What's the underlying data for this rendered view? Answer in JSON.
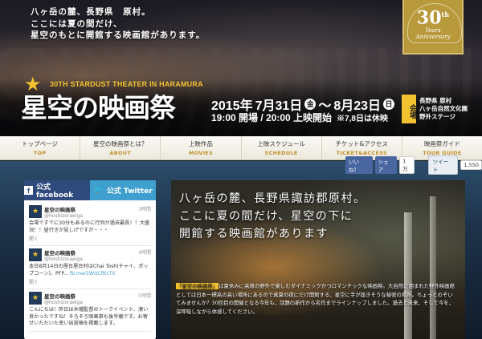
{
  "hero": {
    "tagline": [
      "八ヶ岳の麓、長野県　原村。",
      "ここには夏の間だけ、",
      "星空のもとに開館する映画館があります。"
    ],
    "badge": {
      "number": "30",
      "suffix": "th",
      "line1": "Years",
      "line2": "Anniversary"
    },
    "subtitle": "30TH STARDUST THEATER IN HARAMURA",
    "title": "星空の映画祭",
    "date": {
      "year": "2015年",
      "start": "7月31日",
      "start_dow": "金",
      "sep": "～",
      "end": "8月23日",
      "end_dow": "日"
    },
    "time": {
      "open": "19:00 開場 / 20:00 上映開始",
      "note": "※7,8日は休映"
    },
    "venue": {
      "label": "会場",
      "lines": [
        "長野県 原村",
        "八ヶ岳自然文化園",
        "野外ステージ"
      ]
    }
  },
  "nav": [
    {
      "jp": "トップページ",
      "en": "TOP"
    },
    {
      "jp": "星空の映画祭とは？",
      "en": "ABOUT"
    },
    {
      "jp": "上映作品",
      "en": "MOVIES"
    },
    {
      "jp": "上映スケジュール",
      "en": "SCHEDULE"
    },
    {
      "jp": "チケット&アクセス",
      "en": "TICKET&ACCESS"
    },
    {
      "jp": "映画祭ガイド",
      "en": "TOUR GUIDE"
    }
  ],
  "share": {
    "like": "いいね！",
    "share": "シェア",
    "fb_count": "1万",
    "tweet": "ツイート",
    "tw_count": "1,550"
  },
  "social": {
    "tab_facebook": "公式 facebook",
    "tab_twitter": "公式 Twitter",
    "tweets": [
      {
        "name": "星空の映画祭",
        "handle": "@hoshizoraeiga",
        "time": "3時間",
        "body": "会場ですでに30分もあるのに行列が過去最長！！大盛況！！昼行きが見しげですが・・・",
        "link": "",
        "open": "開く"
      },
      {
        "name": "星空の映画祭",
        "handle": "@hoshizoraeiga",
        "time": "4時間",
        "body": "本日8月14日の屋台屋台村はChai Tosh(チャイ、ポップコーン)、PFP...",
        "link": "fb.me/1WUCfKcTX",
        "open": "開く"
      },
      {
        "name": "星空の映画祭",
        "handle": "@hoshizoraeiga",
        "time": "5時間",
        "body": "こんにちは！昨日は木幡監督のトークイベント、凄い良かったですね！そろそろ映画祭も後半戦です。お寄せいただいた思い出投稿を掲載します。",
        "link": "",
        "open": ""
      }
    ]
  },
  "feature": {
    "heading": [
      "八ヶ岳の麓、長野県諏訪郡原村。",
      "ここに夏の間だけ、星空の下に",
      "開館する映画館があります"
    ],
    "body_highlight": "「星空の映画祭」",
    "body": "は夏休みに高原の野外で楽しむダイナミックかつロマンチックな映画祭。大自然に囲まれた野外映画館としては日本一標高の高い場所にあるので真夏の夜にだけ開館する、星空に手が届きそうな秘密の場所。ちょっとのぞいてみませんか？30回目の開催となる今年も、話題の新作から名作までラインナップしました。過去と未来、そして今を、深呼吸しながら体感してください。"
  }
}
